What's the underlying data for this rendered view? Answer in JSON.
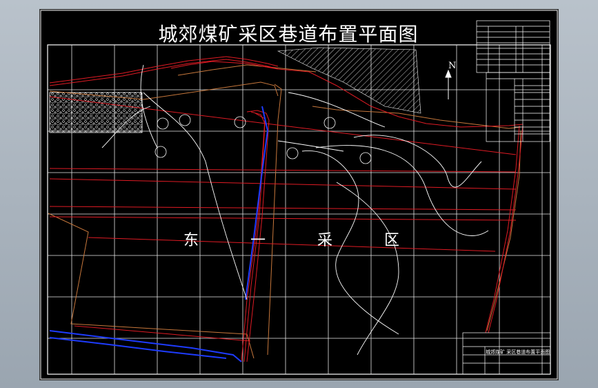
{
  "title": "城郊煤矿采区巷道布置平面图",
  "area_label": "东 一 采 区",
  "north_label": "N",
  "title_block": "城郊煤矿 采区巷道布置平面图",
  "colors": {
    "background": "#000000",
    "frame": "#ffffff",
    "roadway": "#e01b24",
    "boundary": "#c8783c",
    "conveyor": "#1e3cff",
    "contour": "#ffffff"
  }
}
